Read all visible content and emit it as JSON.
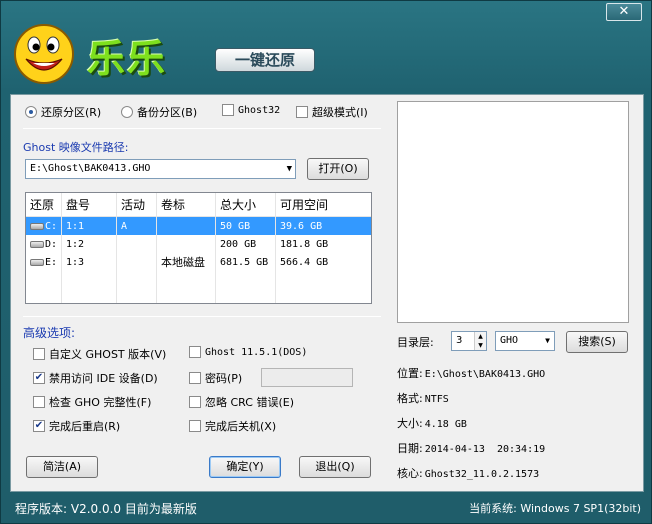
{
  "window": {
    "close_label": "✕"
  },
  "header": {
    "brand": "乐乐",
    "tagline": "一键还原"
  },
  "modes": {
    "restore": "还原分区(R)",
    "backup": "备份分区(B)",
    "ghost32": "Ghost32",
    "super": "超级模式(I)",
    "restore_selected": true
  },
  "image_path": {
    "label": "Ghost 映像文件路径:",
    "value": "E:\\Ghost\\BAK0413.GHO",
    "open_button": "打开(O)"
  },
  "partition_table": {
    "columns": [
      "还原",
      "盘号",
      "活动",
      "卷标",
      "总大小",
      "可用空间"
    ],
    "rows": [
      {
        "drive": "C:",
        "number": "1:1",
        "active": "A",
        "label": "",
        "total": "50 GB",
        "free": "39.6 GB",
        "selected": true
      },
      {
        "drive": "D:",
        "number": "1:2",
        "active": "",
        "label": "",
        "total": "200 GB",
        "free": "181.8 GB",
        "selected": false
      },
      {
        "drive": "E:",
        "number": "1:3",
        "active": "",
        "label": "本地磁盘",
        "total": "681.5 GB",
        "free": "566.4 GB",
        "selected": false
      }
    ]
  },
  "advanced": {
    "title": "高级选项:",
    "custom_ghost": "自定义 GHOST 版本(V)",
    "ghost_version": "Ghost 11.5.1(DOS)",
    "disable_ide": "禁用访问 IDE 设备(D)",
    "password": "密码(P)",
    "password_value": "",
    "check_gho": "检查 GHO 完整性(F)",
    "ignore_crc": "忽略 CRC 错误(E)",
    "reboot": "完成后重启(R)",
    "shutdown": "完成后关机(X)",
    "checked": {
      "custom_ghost": false,
      "ghost_version": false,
      "disable_ide": true,
      "password": false,
      "check_gho": false,
      "ignore_crc": false,
      "reboot": true,
      "shutdown": false
    }
  },
  "actions": {
    "brief": "简洁(A)",
    "confirm": "确定(Y)",
    "exit": "退出(Q)"
  },
  "directory": {
    "label": "目录层:",
    "level": "3",
    "ext": "GHO",
    "search_button": "搜索(S)"
  },
  "file_info": {
    "location_label": "位置:",
    "location": "E:\\Ghost\\BAK0413.GHO",
    "format_label": "格式:",
    "format": "NTFS",
    "size_label": "大小:",
    "size": "4.18 GB",
    "date_label": "日期:",
    "date": "2014-04-13  20:34:19",
    "core_label": "核心:",
    "core": "Ghost32_11.0.2.1573"
  },
  "status_bar": {
    "version": "程序版本: V2.0.0.0  目前为最新版",
    "system": "当前系统: Windows 7 SP1(32bit)"
  },
  "colors": {
    "window_bg": "#1f6270",
    "brand_green": "#7ee01e",
    "selection": "#3399ff",
    "label_blue": "#1a3ab0"
  }
}
